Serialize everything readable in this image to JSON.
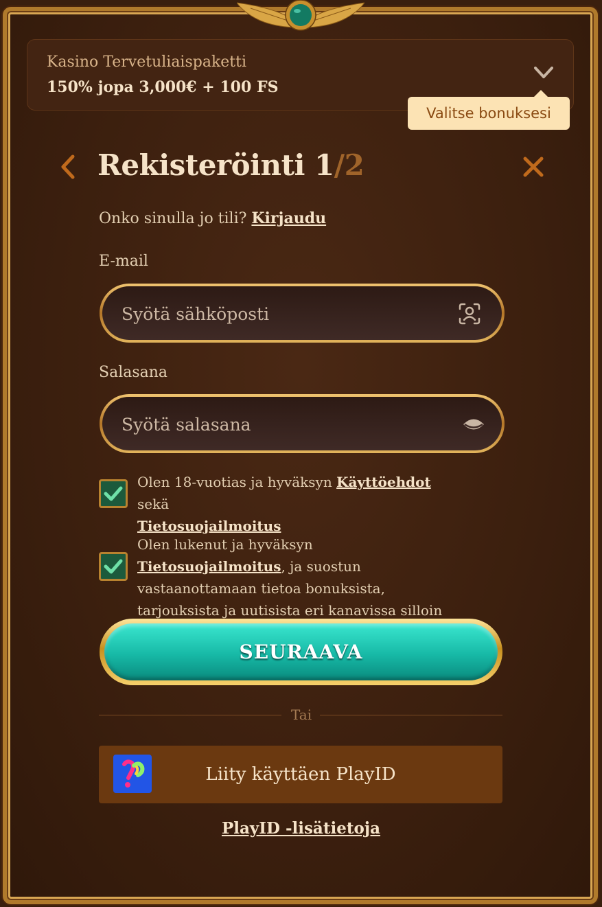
{
  "bonus": {
    "title": "Kasino Tervetuliaispaketti",
    "offer": "150% jopa 3,000€ + 100 FS",
    "tooltip": "Valitse bonuksesi"
  },
  "header": {
    "title_main": "Rekisteröinti 1",
    "title_total": "/2"
  },
  "login_prompt": {
    "text": "Onko sinulla jo tili? ",
    "link": "Kirjaudu"
  },
  "email": {
    "label": "E-mail",
    "placeholder": "Syötä sähköposti",
    "value": ""
  },
  "password": {
    "label": "Salasana",
    "placeholder": "Syötä salasana",
    "value": ""
  },
  "consents": [
    {
      "checked": true,
      "text_before": "Olen 18-vuotias ja hyväksyn ",
      "link1": "Käyttöehdot",
      "text_middle": " sekä ",
      "link2": "Tietosuojailmoitus",
      "text_after": ""
    },
    {
      "checked": true,
      "text_before": "Olen lukenut ja hyväksyn ",
      "link1": "Tietosuojailmoitus",
      "text_after": ", ja suostun vastaanottamaan tietoa bonuksista, tarjouksista ja uutisista eri kanavissa silloin tällöin."
    }
  ],
  "next_button": "SEURAAVA",
  "divider": "Tai",
  "playid": {
    "button": "Liity käyttäen PlayID",
    "info_link": "PlayID -lisätietoja"
  },
  "colors": {
    "background": "#3a1f0e",
    "accent_teal": "#17b9a6",
    "gold": "#d8a653",
    "tooltip_bg": "#fce3b4"
  }
}
